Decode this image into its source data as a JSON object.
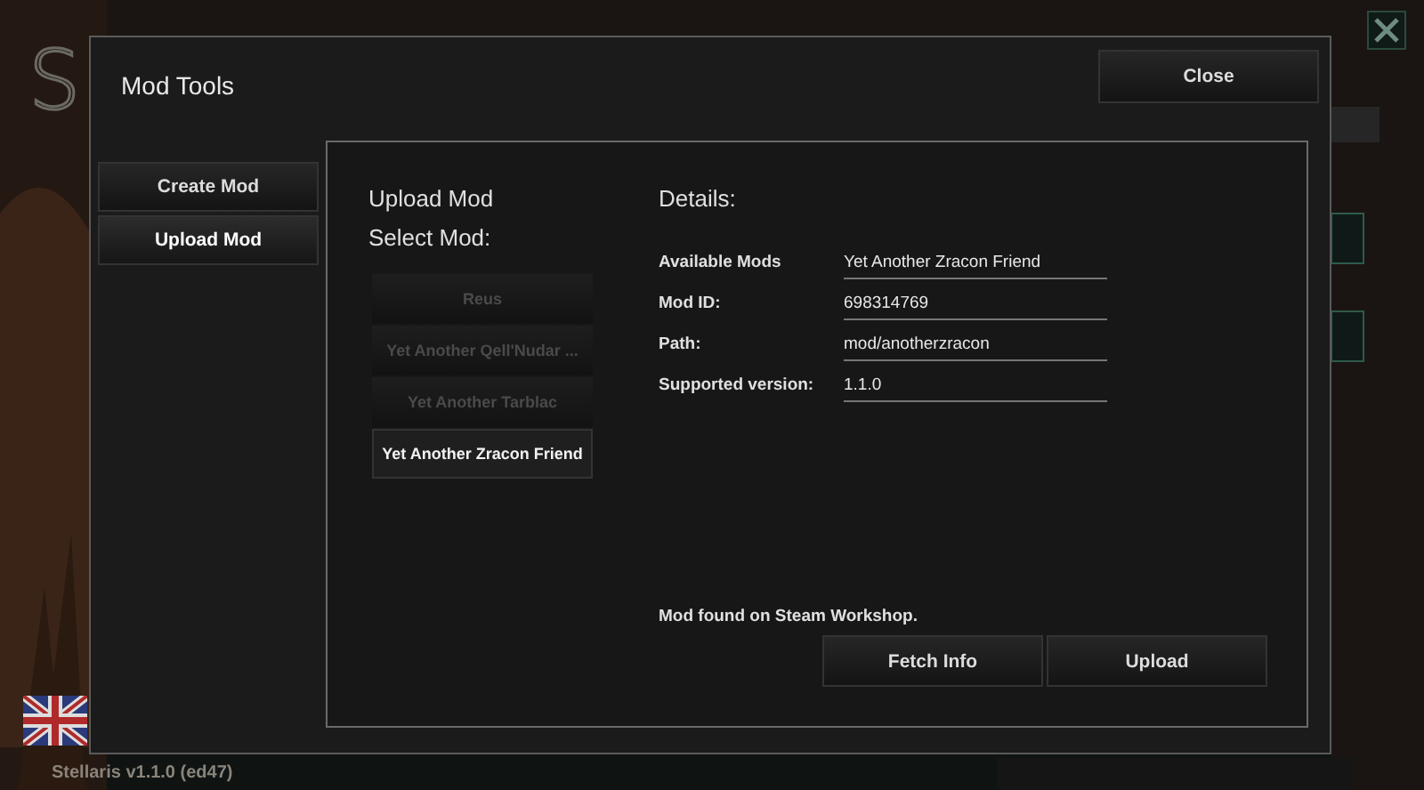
{
  "background": {
    "logo_letter": "S",
    "version": "Stellaris v1.1.0 (ed47)"
  },
  "dialog": {
    "title": "Mod Tools",
    "close_button": "Close",
    "sidebar": [
      {
        "label": "Create Mod",
        "selected": false
      },
      {
        "label": "Upload Mod",
        "selected": true
      }
    ],
    "panel": {
      "heading": "Upload Mod",
      "select_label": "Select Mod:",
      "mods": [
        {
          "label": "Reus",
          "selected": false
        },
        {
          "label": "Yet Another Qell'Nudar ...",
          "selected": false
        },
        {
          "label": "Yet Another Tarblac",
          "selected": false
        },
        {
          "label": "Yet Another Zracon Friend",
          "selected": true
        }
      ],
      "details_heading": "Details:",
      "details": [
        {
          "label": "Available Mods",
          "value": "Yet Another Zracon Friend"
        },
        {
          "label": "Mod ID:",
          "value": "698314769"
        },
        {
          "label": "Path:",
          "value": "mod/anotherzracon"
        },
        {
          "label": "Supported version:",
          "value": "1.1.0"
        }
      ],
      "status": "Mod found on Steam Workshop.",
      "buttons": [
        "Fetch Info",
        "Upload"
      ]
    }
  }
}
